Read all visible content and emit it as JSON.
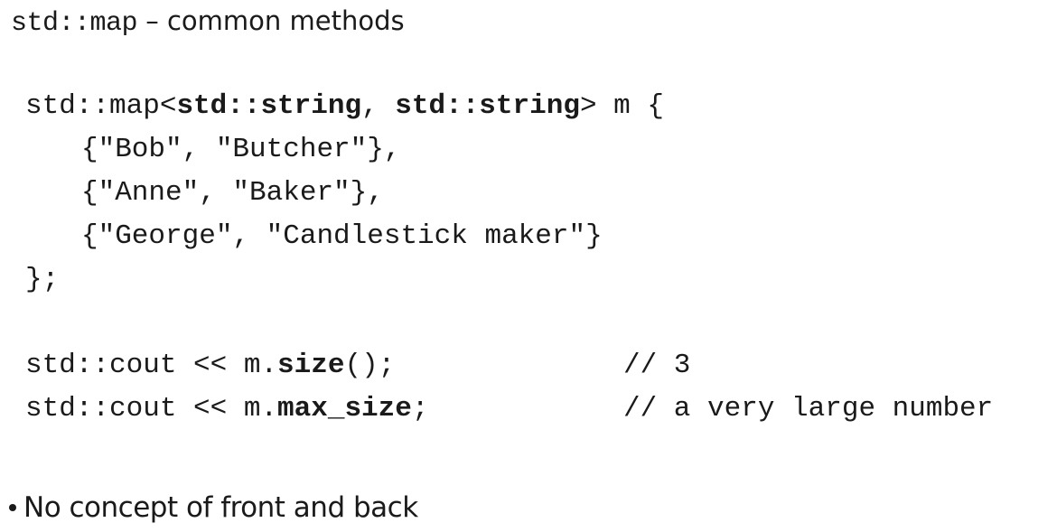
{
  "title": {
    "code": "std::map",
    "text": " – common methods"
  },
  "code": {
    "declaration": {
      "prefix": "std::map<",
      "arg1": "std::string",
      "sep": ", ",
      "arg2": "std::string",
      "suffix": "> m {"
    },
    "entries": [
      "{\"Bob\", \"Butcher\"},",
      "{\"Anne\", \"Baker\"},",
      "{\"George\", \"Candlestick maker\"}"
    ],
    "closing": "};",
    "size_call": {
      "prefix": "std::cout << m.",
      "method": "size",
      "suffix": "();",
      "comment": "// 3"
    },
    "max_size_call": {
      "prefix": "std::cout << m.",
      "method": "max_size",
      "suffix": ";",
      "comment": "// a very large number"
    }
  },
  "bullets": [
    "No concept of front and back"
  ]
}
